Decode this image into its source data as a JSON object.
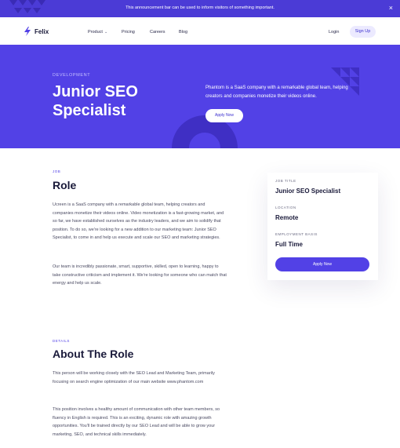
{
  "announcement": {
    "text": "This announcement bar can be used to inform visitors of something important.",
    "close_icon": "×"
  },
  "nav": {
    "logo_text": "Felix",
    "links": [
      {
        "label": "Product",
        "has_dropdown": true
      },
      {
        "label": "Pricing"
      },
      {
        "label": "Careers"
      },
      {
        "label": "Blog"
      }
    ],
    "login": "Login",
    "signup": "Sign Up"
  },
  "hero": {
    "eyebrow": "DEVELOPMENT",
    "title": "Junior SEO Specialist",
    "description": "Phantom is a SaaS company with a remarkable global team, helping creators and companies monetize their videos online.",
    "button": "Apply Now"
  },
  "job": {
    "label": "JOB",
    "title": "Role",
    "paragraphs": [
      "Ucreen is a SaaS company with a remarkable global team, helping creators and companies monetize their videos online. Video monetization is a fast-growing market, and so far, we have established ourselves as the industry leaders, and we aim to solidify that position. To do so, we're looking for a new addition to our marketing team: Junior SEO Specialist, to come in and help us execute and scale our SEO and marketing strategies.",
      "Our team is incredibly passionate, smart, supportive, skilled, open to learning, happy to take constructive criticism and implement it. We're looking for someone who can match that energy and help us scale."
    ]
  },
  "sidebar_card": {
    "job_title_label": "JOB TITLE",
    "job_title": "Junior SEO Specialist",
    "location_label": "LOCATION",
    "location": "Remote",
    "employment_label": "EMPLOYMENT BASIS",
    "employment": "Full Time",
    "button": "Apply Now"
  },
  "details": {
    "label": "DETAILS",
    "title": "About The Role",
    "paragraphs": [
      "This person will be working closely with the SEO Lead and Marketing Team, primarily focusing on search engine optimization of our main website www.phantom.com",
      "This position involves a healthy amount of communication with other team members, so fluency in English is required. This is an exciting, dynamic role with amazing growth opportunities. You'll be trained directly by our SEO Lead and will be able to grow your marketing, SEO, and technical skills immediately."
    ]
  },
  "colors": {
    "brand": "#5241e6",
    "announcement_bg": "#4b3bd6",
    "hero_bg": "#5241e6",
    "signup_bg": "#eceaff",
    "heading": "#1a1a3a"
  },
  "icons": {
    "logo": "bolt-icon",
    "close": "close-icon",
    "dropdown": "chevron-down-icon"
  }
}
